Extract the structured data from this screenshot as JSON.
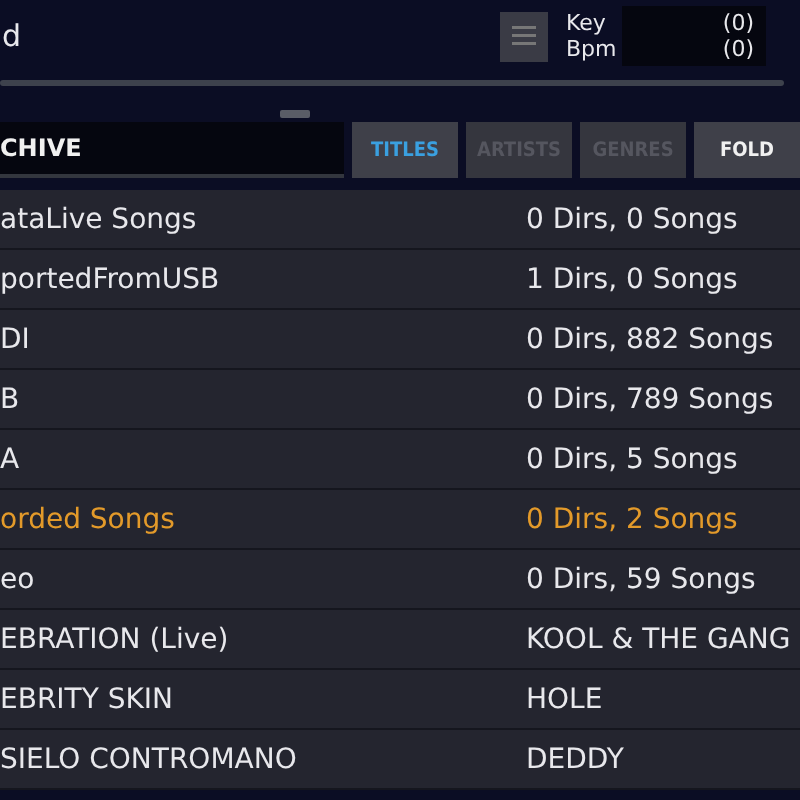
{
  "header": {
    "title": "d",
    "key_label": "Key",
    "bpm_label": "Bpm",
    "key_value": "(0)",
    "bpm_value": "(0)"
  },
  "search": {
    "value": "CHIVE"
  },
  "tabs": [
    {
      "label": "TITLES",
      "selected": true,
      "disabled": false
    },
    {
      "label": "ARTISTS",
      "selected": false,
      "disabled": true
    },
    {
      "label": "GENRES",
      "selected": false,
      "disabled": true
    },
    {
      "label": "FOLD",
      "selected": false,
      "disabled": false
    }
  ],
  "rows": [
    {
      "name": "ataLive Songs",
      "info": "0 Dirs, 0 Songs",
      "highlighted": false
    },
    {
      "name": "portedFromUSB",
      "info": "1 Dirs, 0 Songs",
      "highlighted": false
    },
    {
      "name": "DI",
      "info": "0 Dirs, 882 Songs",
      "highlighted": false
    },
    {
      "name": "B",
      "info": "0 Dirs, 789 Songs",
      "highlighted": false
    },
    {
      "name": "A",
      "info": "0 Dirs, 5 Songs",
      "highlighted": false
    },
    {
      "name": "orded Songs",
      "info": "0 Dirs, 2 Songs",
      "highlighted": true
    },
    {
      "name": "eo",
      "info": "0 Dirs, 59 Songs",
      "highlighted": false
    },
    {
      "name": "EBRATION (Live)",
      "info": "KOOL & THE GANG",
      "highlighted": false
    },
    {
      "name": "EBRITY SKIN",
      "info": "HOLE",
      "highlighted": false
    },
    {
      "name": "SIELO CONTROMANO",
      "info": "DEDDY",
      "highlighted": false
    }
  ]
}
